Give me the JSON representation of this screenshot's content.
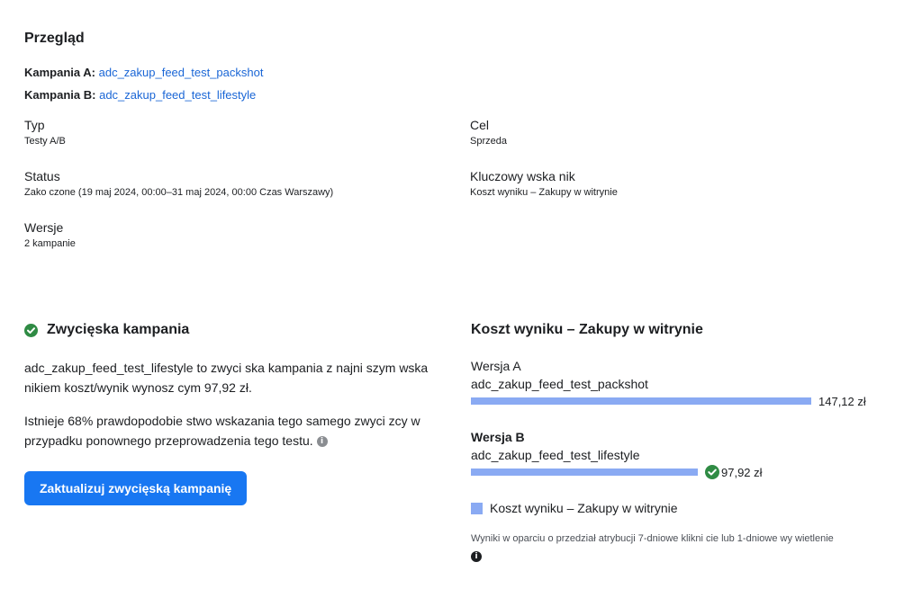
{
  "overview": {
    "title": "Przegląd",
    "campaign_a_label": "Kampania A:",
    "campaign_a_name": "adc_zakup_feed_test_packshot",
    "campaign_b_label": "Kampania B:",
    "campaign_b_name": "adc_zakup_feed_test_lifestyle",
    "type_label": "Typ",
    "type_value": "Testy A/B",
    "goal_label": "Cel",
    "goal_value": "Sprzeda",
    "status_label": "Status",
    "status_value": "Zako czone (19 maj 2024, 00:00–31 maj 2024, 00:00 Czas Warszawy)",
    "key_metric_label": "Kluczowy wska nik",
    "key_metric_value": "Koszt wyniku – Zakupy w witrynie",
    "versions_label": "Wersje",
    "versions_value": "2 kampanie"
  },
  "winner": {
    "title": "Zwycięska kampania",
    "description": "adc_zakup_feed_test_lifestyle to zwyci ska kampania z najni szym wska nikiem koszt/wynik wynosz cym 97,92 zł.",
    "probability": "Istnieje 68% prawdopodobie stwo wskazania tego samego zwyci zcy w przypadku ponownego przeprowadzenia tego testu.",
    "button_label": "Zaktualizuj zwycięską kampanię"
  },
  "cost_chart": {
    "title": "Koszt wyniku – Zakupy w witrynie",
    "legend_label": "Koszt wyniku – Zakupy w witrynie",
    "footnote": "Wyniki w oparciu o przedział atrybucji 7-dniowe klikni cie lub 1-dniowe wy wietlenie",
    "bar_color": "#8aaaf3",
    "winner_color": "#2f8b44"
  },
  "chart_data": {
    "type": "bar",
    "orientation": "horizontal",
    "title": "Koszt wyniku – Zakupy w witrynie",
    "categories": [
      "Wersja A",
      "Wersja B"
    ],
    "campaigns": [
      "adc_zakup_feed_test_packshot",
      "adc_zakup_feed_test_lifestyle"
    ],
    "values": [
      147.12,
      97.92
    ],
    "value_labels": [
      "147,12 zł",
      "97,92 zł"
    ],
    "winner_index": 1,
    "series": [
      {
        "name": "Koszt wyniku – Zakupy w witrynie",
        "values": [
          147.12,
          97.92
        ]
      }
    ],
    "legend": "bottom"
  }
}
